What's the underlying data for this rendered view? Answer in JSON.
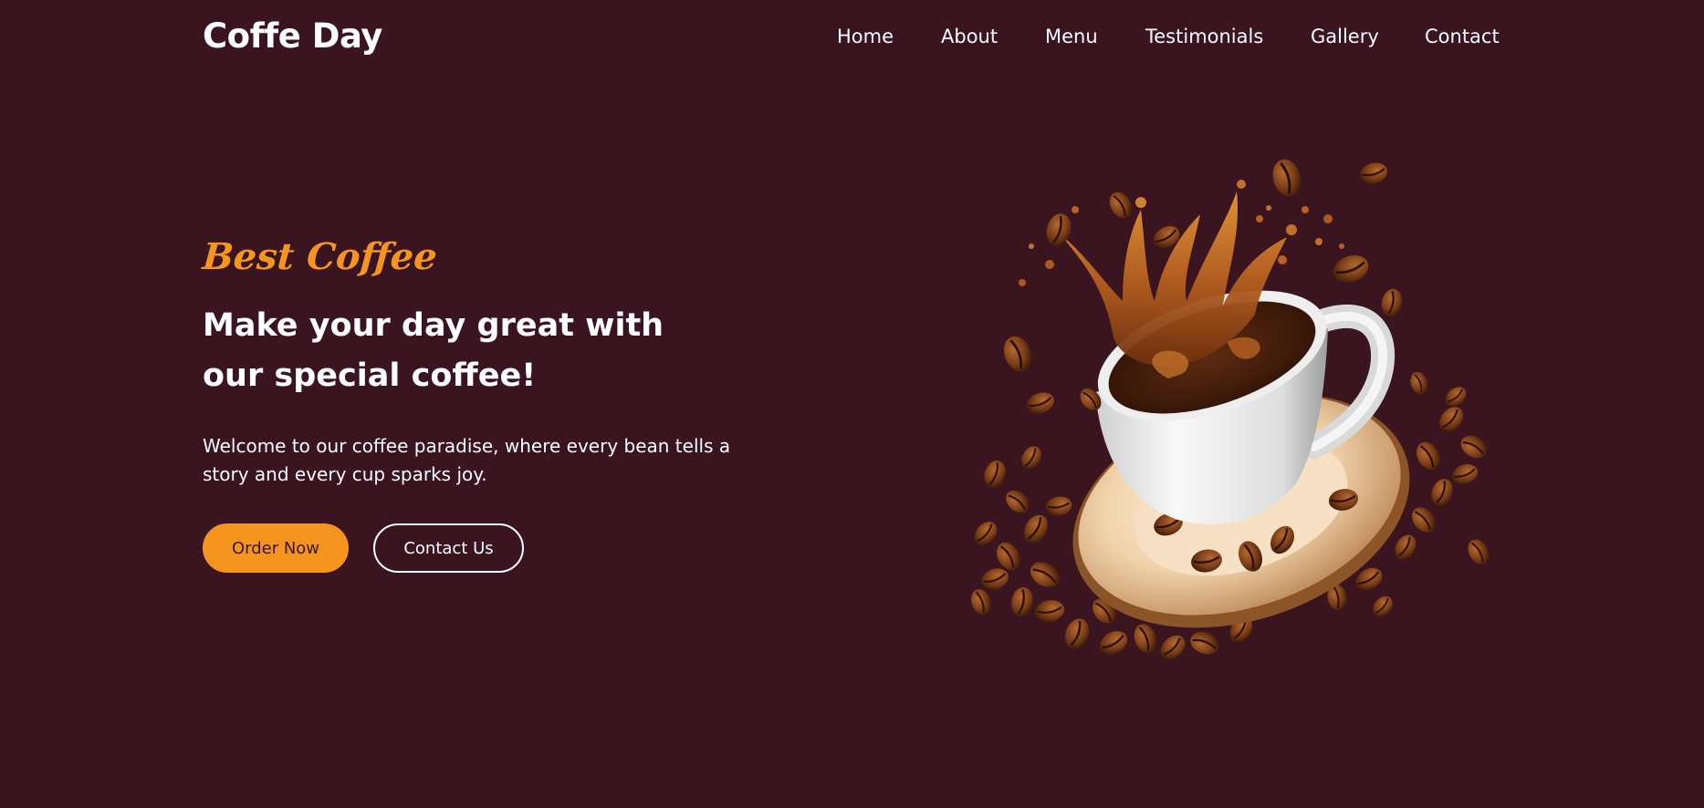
{
  "header": {
    "brand": "Coffe Day",
    "nav": [
      "Home",
      "About",
      "Menu",
      "Testimonials",
      "Gallery",
      "Contact"
    ]
  },
  "hero": {
    "tagline": "Best Coffee",
    "headline": "Make your day great with our special coffee!",
    "description": "Welcome to our coffee paradise, where every bean tells a story and every cup sparks joy.",
    "buttons": {
      "order": "Order Now",
      "contact": "Contact Us"
    }
  },
  "colors": {
    "background": "#3a141e",
    "accent": "#f3951f",
    "text": "#ffffff"
  },
  "image": {
    "icon": "coffee-cup-splash-illustration"
  }
}
